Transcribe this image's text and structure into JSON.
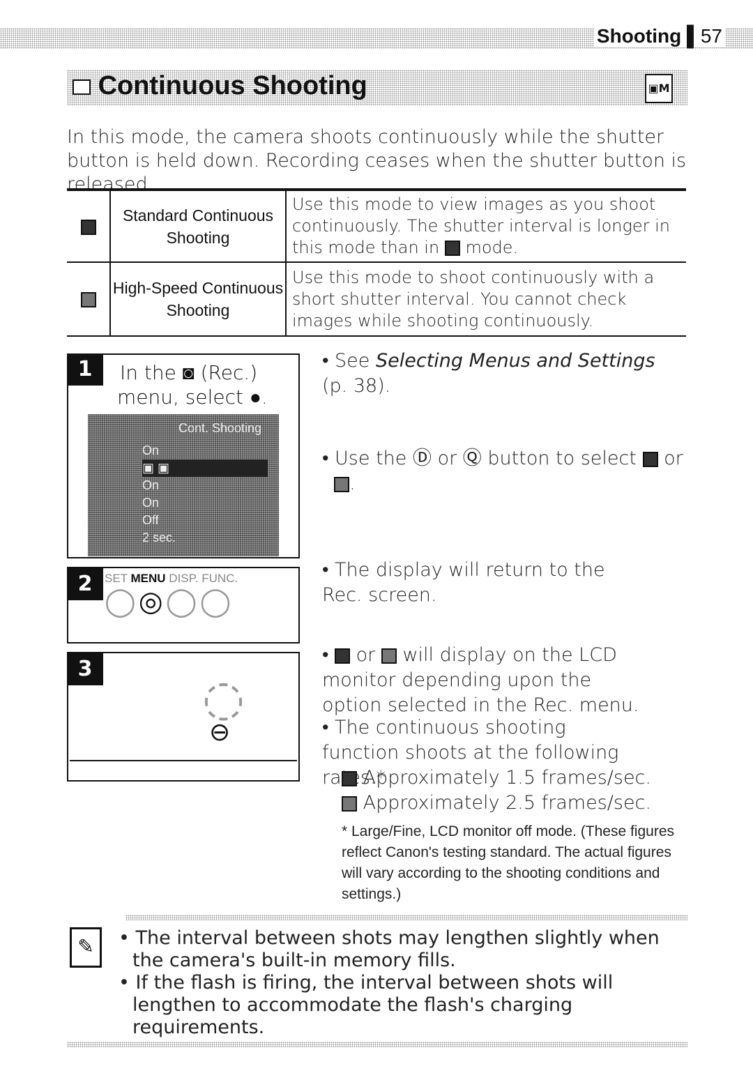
{
  "header": {
    "section": "Shooting",
    "page_number": "57"
  },
  "title": "Continuous Shooting",
  "intro": "In this mode, the camera shoots continuously while the shutter button is held down. Recording ceases when the shutter button is released.",
  "modes": [
    {
      "name": "Standard Continuous Shooting",
      "desc_a": "Use this mode to view images as you shoot continuously. The shutter interval is longer in this mode than in",
      "desc_b": "mode."
    },
    {
      "name": "High-Speed Continuous Shooting",
      "desc": "Use this mode to shoot continuously with a short shutter interval. You cannot check images while shooting continuously."
    }
  ],
  "steps": [
    {
      "number": "1",
      "text_a": "In the",
      "text_b": "(Rec.)",
      "text_c": "menu, select",
      "text_d": "."
    },
    {
      "number": "2"
    },
    {
      "number": "3"
    }
  ],
  "lcd_menu": {
    "title": "Cont. Shooting",
    "values": [
      "On",
      "",
      "On",
      "On",
      "Off",
      "2 sec."
    ]
  },
  "camera_labels": {
    "set": "SET",
    "menu": "MENU",
    "disp": "DISP.",
    "func": "FUNC."
  },
  "bullets": {
    "b1_a": "See",
    "b1_italic": "Selecting Menus and Settings",
    "b1_b": "(p. 38).",
    "b2_a": "Use the",
    "b2_b": "or",
    "b2_c": "button to select",
    "b2_d": "or",
    "b3": "The display will return to the Rec. screen.",
    "b4_a": "or",
    "b4_b": "will display on the LCD monitor depending upon the option selected in the Rec. menu.",
    "b5": "The continuous shooting function shoots at the following rates.*",
    "rate1": "Approximately 1.5 frames/sec.",
    "rate2": "Approximately 2.5 frames/sec.",
    "footnote": "* Large/Fine, LCD monitor off mode. (These figures reflect Canon's testing standard. The actual figures will vary according to the shooting conditions and settings.)"
  },
  "notes": [
    "The interval between shots may lengthen slightly when the camera's built-in memory fills.",
    "If the flash is firing, the interval between shots will lengthen to accommodate the flash's charging requirements."
  ]
}
